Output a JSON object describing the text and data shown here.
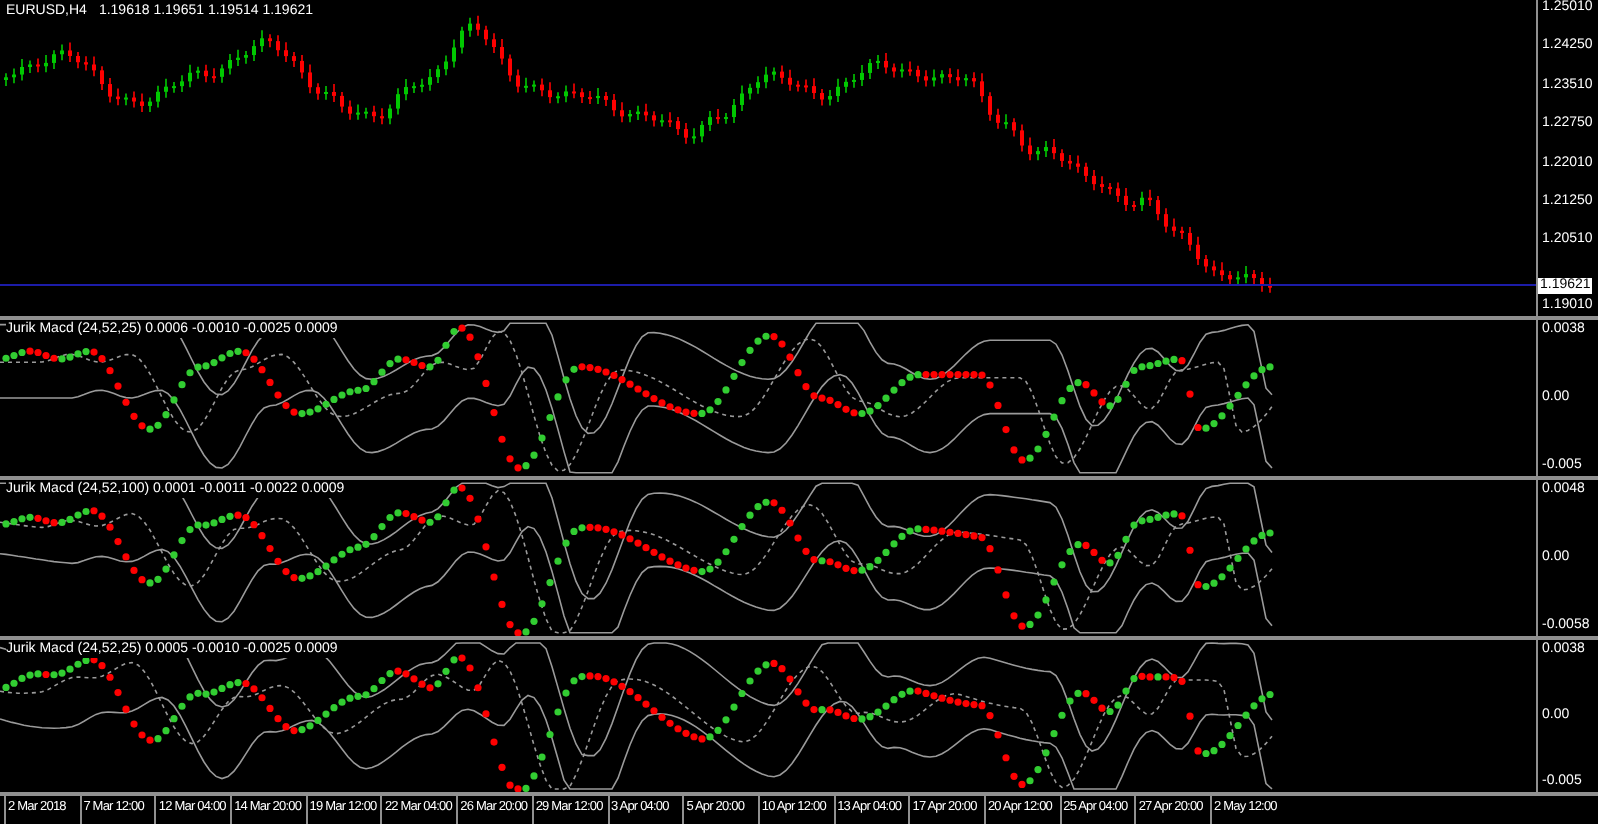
{
  "main_chart": {
    "symbol": "EURUSD,H4",
    "quote": "1.19618 1.19651 1.19514 1.19621",
    "price_ticks": [
      "1.25010",
      "1.24250",
      "1.23510",
      "1.22750",
      "1.22010",
      "1.21250",
      "1.20510"
    ],
    "bottom_tick": "1.19010",
    "current_price": "1.19621"
  },
  "indicators": [
    {
      "title": "Jurik Macd (24,52,25) 0.0006 -0.0010 -0.0025 0.0009",
      "ticks": [
        "0.0038",
        "0.00",
        "-0.005"
      ]
    },
    {
      "title": "Jurik Macd (24,52,100) 0.0001 -0.0011 -0.0022 0.0009",
      "ticks": [
        "0.0048",
        "0.00",
        "-0.0058"
      ]
    },
    {
      "title": "Jurik Macd (24,52,25) 0.0005 -0.0010 -0.0025 0.0009",
      "ticks": [
        "0.0038",
        "0.00",
        "-0.005"
      ]
    }
  ],
  "time_axis": [
    "2 Mar 2018",
    "7 Mar 12:00",
    "12 Mar 04:00",
    "14 Mar 20:00",
    "19 Mar 12:00",
    "22 Mar 04:00",
    "26 Mar 20:00",
    "29 Mar 12:00",
    "3 Apr 04:00",
    "5 Apr 20:00",
    "10 Apr 12:00",
    "13 Apr 04:00",
    "17 Apr 20:00",
    "20 Apr 12:00",
    "25 Apr 04:00",
    "27 Apr 20:00",
    "2 May 12:00"
  ]
}
